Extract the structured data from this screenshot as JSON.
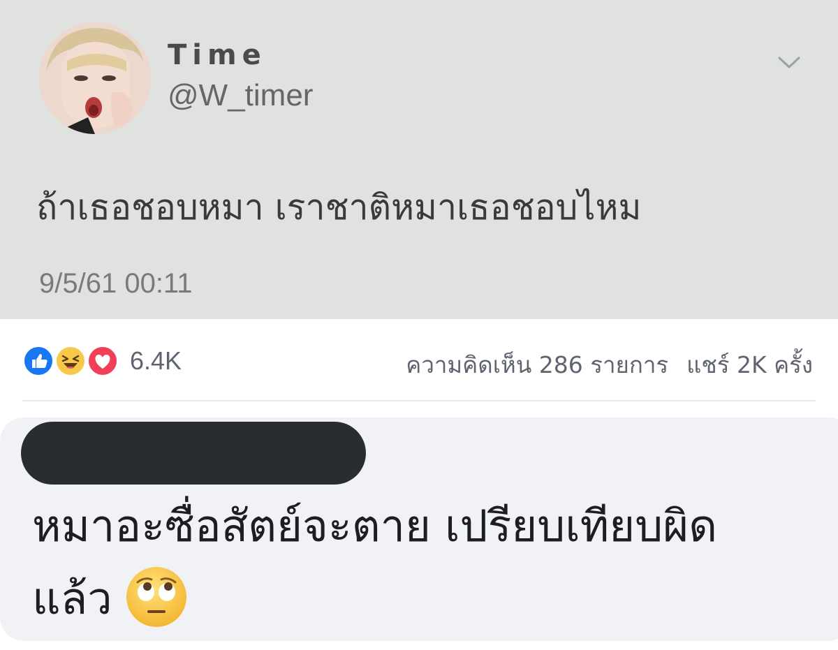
{
  "tweet": {
    "display_name": "Time",
    "handle": "@W_timer",
    "text": "ถ้าเธอชอบหมา เราชาติหมาเธอชอบไหม",
    "timestamp": "9/5/61 00:11",
    "menu_icon": "chevron-down-icon"
  },
  "reactions": {
    "icons": [
      "like-icon",
      "haha-icon",
      "love-icon"
    ],
    "count": "6.4K",
    "comments_label": "ความคิดเห็น 286 รายการ",
    "shares_label": "แชร์ 2K ครั้ง"
  },
  "comment": {
    "line1": "หมาอะซื่อสัตย์จะตาย เปรียบเทียบผิด",
    "line2": "แล้ว",
    "emoji": "eye-roll-emoji"
  },
  "colors": {
    "tweet_bg": "#dfe2df",
    "like_blue": "#1877f2",
    "love_red": "#f33e58",
    "haha_yellow": "#f7c94a",
    "comment_bg": "#f0f2f5"
  }
}
